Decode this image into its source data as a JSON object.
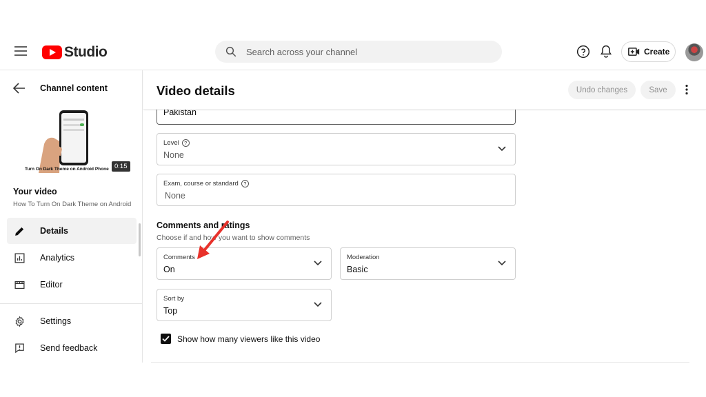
{
  "header": {
    "brand": "Studio",
    "search_placeholder": "Search across your channel",
    "create_label": "Create"
  },
  "sidebar": {
    "back_label": "Channel content",
    "thumbnail_caption": "Turn On Dark Theme on Android Phone",
    "duration": "0:15",
    "your_video_label": "Your video",
    "video_title": "How To Turn On Dark Theme on Android Phone",
    "nav": [
      {
        "label": "Details",
        "icon": "pencil-icon",
        "active": true
      },
      {
        "label": "Analytics",
        "icon": "analytics-icon"
      },
      {
        "label": "Editor",
        "icon": "editor-icon"
      }
    ],
    "footer": [
      {
        "label": "Settings",
        "icon": "gear-icon"
      },
      {
        "label": "Send feedback",
        "icon": "feedback-icon"
      }
    ]
  },
  "main": {
    "title": "Video details",
    "undo_label": "Undo changes",
    "save_label": "Save",
    "country_value": "Pakistan",
    "level": {
      "label": "Level",
      "value": "None"
    },
    "exam": {
      "label": "Exam, course or standard",
      "value": "None"
    },
    "comments_section": {
      "title": "Comments and ratings",
      "subtitle": "Choose if and how you want to show comments"
    },
    "comments": {
      "label": "Comments",
      "value": "On"
    },
    "moderation": {
      "label": "Moderation",
      "value": "Basic"
    },
    "sort_by": {
      "label": "Sort by",
      "value": "Top"
    },
    "show_likes_label": "Show how many viewers like this video",
    "show_likes_checked": true
  },
  "colors": {
    "brand_red": "#ff0000",
    "annotation_arrow": "#e8322b"
  }
}
